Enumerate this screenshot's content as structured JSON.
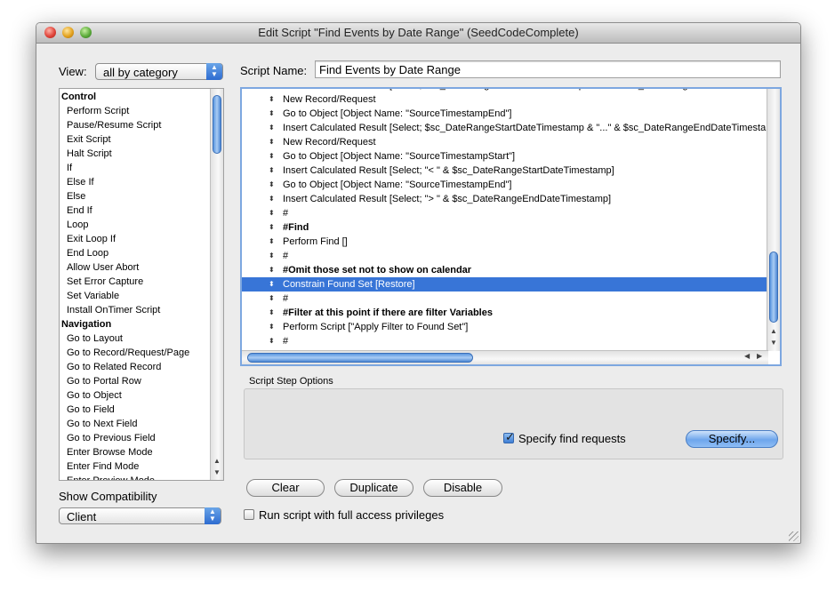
{
  "window": {
    "title": "Edit Script \"Find Events by Date Range\" (SeedCodeComplete)"
  },
  "view": {
    "label": "View:",
    "value": "all by category"
  },
  "script_name": {
    "label": "Script Name:",
    "value": "Find Events by Date Range"
  },
  "step_list": [
    {
      "label": "Control",
      "category": true
    },
    {
      "label": "Perform Script"
    },
    {
      "label": "Pause/Resume Script"
    },
    {
      "label": "Exit Script"
    },
    {
      "label": "Halt Script"
    },
    {
      "label": "If"
    },
    {
      "label": "Else If"
    },
    {
      "label": "Else"
    },
    {
      "label": "End If"
    },
    {
      "label": "Loop"
    },
    {
      "label": "Exit Loop If"
    },
    {
      "label": "End Loop"
    },
    {
      "label": "Allow User Abort"
    },
    {
      "label": "Set Error Capture"
    },
    {
      "label": "Set Variable"
    },
    {
      "label": "Install OnTimer Script"
    },
    {
      "label": "Navigation",
      "category": true
    },
    {
      "label": "Go to Layout"
    },
    {
      "label": "Go to Record/Request/Page"
    },
    {
      "label": "Go to Related Record"
    },
    {
      "label": "Go to Portal Row"
    },
    {
      "label": "Go to Object"
    },
    {
      "label": "Go to Field"
    },
    {
      "label": "Go to Next Field"
    },
    {
      "label": "Go to Previous Field"
    },
    {
      "label": "Enter Browse Mode"
    },
    {
      "label": "Enter Find Mode"
    },
    {
      "label": "Enter Preview Mode"
    }
  ],
  "script_lines": [
    {
      "text": "Insert Calculated Result [Select; $sc_DateRangeStartDateTimestamp & \"...\" & $sc_DateRangeEndDateTimestamp]"
    },
    {
      "text": "New Record/Request"
    },
    {
      "text": "Go to Object [Object Name: \"SourceTimestampEnd\"]"
    },
    {
      "text": "Insert Calculated Result [Select; $sc_DateRangeStartDateTimestamp & \"...\" & $sc_DateRangeEndDateTimestamp]"
    },
    {
      "text": "New Record/Request"
    },
    {
      "text": "Go to Object [Object Name: \"SourceTimestampStart\"]"
    },
    {
      "text": "Insert Calculated Result [Select; \"< \" & $sc_DateRangeStartDateTimestamp]"
    },
    {
      "text": "Go to Object [Object Name: \"SourceTimestampEnd\"]"
    },
    {
      "text": "Insert Calculated Result [Select; \"> \" & $sc_DateRangeEndDateTimestamp]"
    },
    {
      "text": "#"
    },
    {
      "text": "#Find",
      "bold": true
    },
    {
      "text": "Perform Find []"
    },
    {
      "text": "#"
    },
    {
      "text": "#Omit those set not to show on calendar",
      "bold": true
    },
    {
      "text": "Constrain Found Set [Restore]",
      "selected": true
    },
    {
      "text": "#"
    },
    {
      "text": "#Filter at this point if there are filter Variables",
      "bold": true
    },
    {
      "text": "Perform Script [\"Apply Filter to Found Set\"]"
    },
    {
      "text": "#"
    }
  ],
  "options": {
    "group_label": "Script Step Options",
    "specify_find_label": "Specify find requests",
    "specify_find_checked": true,
    "specify_button": "Specify..."
  },
  "buttons": {
    "clear": "Clear",
    "duplicate": "Duplicate",
    "disable": "Disable"
  },
  "compatibility": {
    "label": "Show Compatibility",
    "value": "Client"
  },
  "full_access": {
    "label": "Run script with full access privileges",
    "checked": false
  }
}
